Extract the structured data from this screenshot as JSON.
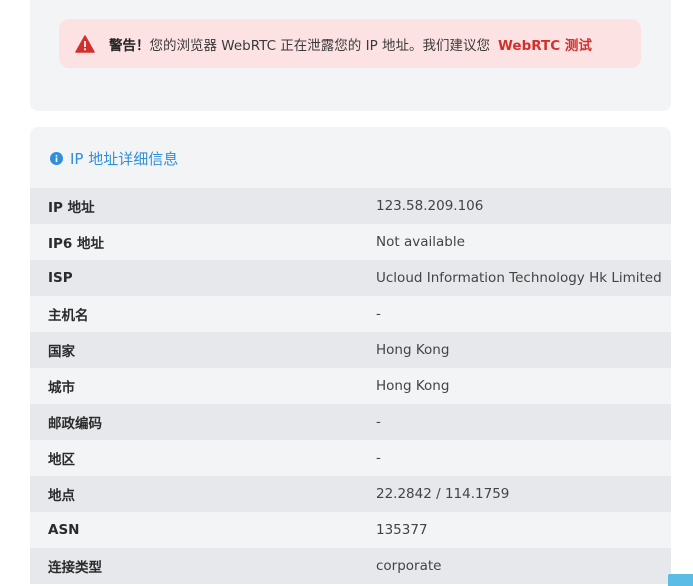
{
  "alert": {
    "prefix": "警告！",
    "message": "您的浏览器 WebRTC 正在泄露您的 IP 地址。我们建议您",
    "link_label": "WebRTC 测试",
    "accent_color": "#d0312d",
    "icon": "warning-triangle-icon"
  },
  "ip_card": {
    "title": "IP 地址详细信息",
    "icon": "info-circle-icon",
    "title_color": "#2f8fd8",
    "rows": [
      {
        "label": "IP 地址",
        "value": "123.58.209.106"
      },
      {
        "label": "IP6 地址",
        "value": "Not available"
      },
      {
        "label": "ISP",
        "value": "Ucloud Information Technology Hk Limited"
      },
      {
        "label": "主机名",
        "value": "-"
      },
      {
        "label": "国家",
        "value": "Hong Kong"
      },
      {
        "label": "城市",
        "value": "Hong Kong"
      },
      {
        "label": "邮政编码",
        "value": "-"
      },
      {
        "label": "地区",
        "value": "-"
      },
      {
        "label": "地点",
        "value": "22.2842 / 114.1759"
      },
      {
        "label": "ASN",
        "value": "135377"
      },
      {
        "label": "连接类型",
        "value": "corporate"
      }
    ]
  }
}
